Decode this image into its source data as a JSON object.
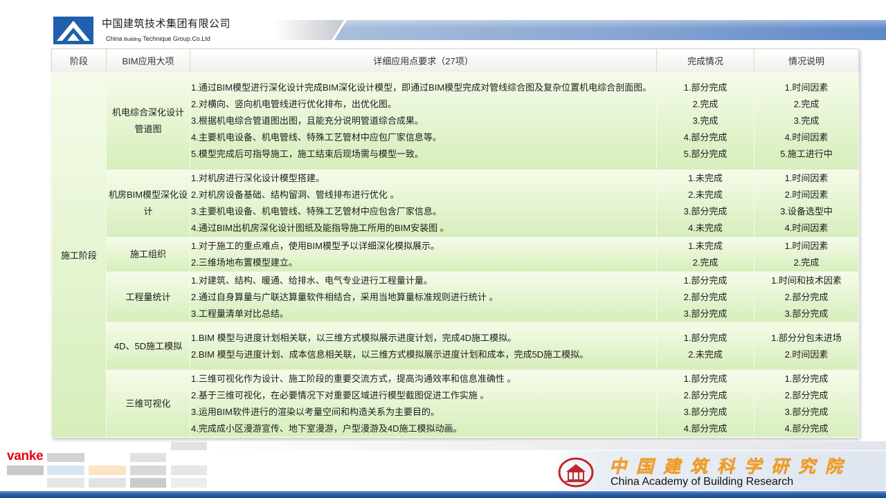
{
  "header": {
    "company_cn": "中国建筑技术集团有限公司",
    "company_en": {
      "part1": "China",
      "part2": "Building",
      "part3": "Technique Group.Co.Ltd"
    }
  },
  "table": {
    "columns": [
      "阶段",
      "BIM应用大项",
      "详细应用点要求（27项）",
      "完成情况",
      "情况说明"
    ],
    "stage": "施工阶段",
    "rows": [
      {
        "category": "机电综合深化设计管道图",
        "items": [
          "1.通过BIM模型进行深化设计完成BIM深化设计模型，即通过BIM模型完成对管线综合图及复杂位置机电综合剖面图。",
          "2.对横向、竖向机电管线进行优化排布，出优化图。",
          "3.根据机电综合管道图出图，且能充分说明管道综合成果。",
          "4.主要机电设备、机电管线、特殊工艺管材中应包厂家信息等。",
          "5.模型完成后可指导施工，施工结束后现场需与模型一致。"
        ],
        "status": [
          "1.部分完成",
          "2.完成",
          "3.完成",
          "4.部分完成",
          "5.部分完成"
        ],
        "notes": [
          "1.时间因素",
          "2.完成",
          "3.完成",
          "4.时间因素",
          "5.施工进行中"
        ]
      },
      {
        "category": "机房BIM模型深化设计",
        "items": [
          "1.对机房进行深化设计模型搭建。",
          "2.对机房设备基础、结构留洞、管线排布进行优化 。",
          "3.主要机电设备、机电管线、特殊工艺管材中应包含厂家信息。",
          "4.通过BIM出机房深化设计图纸及能指导施工所用的BIM安装图 。"
        ],
        "status": [
          "1.未完成",
          "2.未完成",
          "3.部分完成",
          "4.未完成"
        ],
        "notes": [
          "1.时间因素",
          "2.时间因素",
          "3.设备选型中",
          "4.时间因素"
        ]
      },
      {
        "category": "施工组织",
        "items": [
          "1.对于施工的重点难点，使用BIM模型予以详细深化模拟展示。",
          "2.三维场地布置模型建立。"
        ],
        "status": [
          "1.未完成",
          "2.完成"
        ],
        "notes": [
          "1.时间因素",
          "2.完成"
        ]
      },
      {
        "category": "工程量统计",
        "items": [
          "1.对建筑、结构、暖通、给排水、电气专业进行工程量计量。",
          "2.通过自身算量与广联达算量软件相结合，采用当地算量标准规则进行统计 。",
          "3.工程量清单对比总结。"
        ],
        "status": [
          "1.部分完成",
          "2.部分完成",
          "3.部分完成"
        ],
        "notes": [
          "1.时间和技术因素",
          "2.部分完成",
          "3.部分完成"
        ]
      },
      {
        "category": "4D、5D施工模拟",
        "items": [
          "1.BIM 模型与进度计划相关联，以三维方式模拟展示进度计划，完成4D施工模拟。",
          "2.BIM 模型与进度计划、成本信息相关联，以三维方式模拟展示进度计划和成本，完成5D施工模拟。"
        ],
        "status": [
          "1.部分完成",
          "2.未完成"
        ],
        "notes": [
          "1.部分分包未进场",
          "2.时间因素"
        ]
      },
      {
        "category": "三维可视化",
        "items": [
          "1.三维可视化作为设计、施工阶段的重要交流方式，提高沟通效率和信息准确性 。",
          "2.基于三维可视化，在必要情况下对重要区域进行模型截图促进工作实施 。",
          "3.运用BIM软件进行的渲染以考量空间和构造关系为主要目的。",
          "4.完成成小区漫游宣传、地下室漫游，户型漫游及4D施工模拟动画。"
        ],
        "status": [
          "1.部分完成",
          "2.部分完成",
          "3.部分完成",
          "4.部分完成"
        ],
        "notes": [
          "1.部分完成",
          "2.部分完成",
          "3.部分完成",
          "4.部分完成"
        ]
      }
    ]
  },
  "footer": {
    "brand_logo": "vanke",
    "org_cn": "中国建筑科学研究院",
    "org_en": "China Academy of Building Research"
  },
  "colors": {
    "brand_blue": "#1f5fad",
    "table_green": "#d6eebb",
    "vanke_red": "#e60012",
    "org_orange": "#f39c1f"
  }
}
